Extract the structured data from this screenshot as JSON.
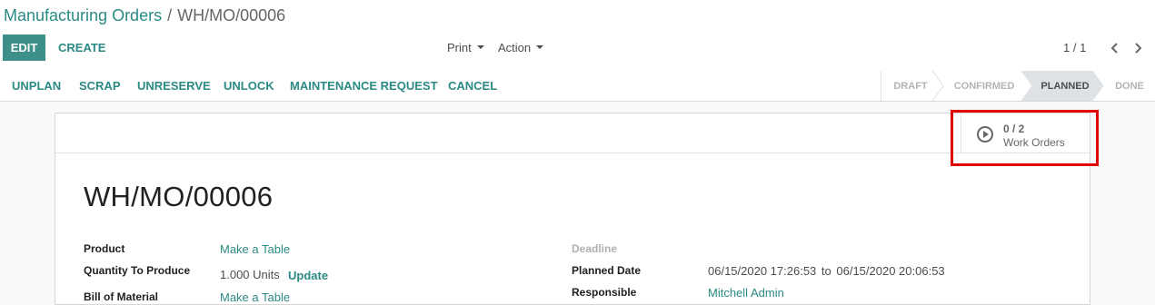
{
  "breadcrumb": {
    "parent": "Manufacturing Orders",
    "separator": "/",
    "current": "WH/MO/00006"
  },
  "buttons": {
    "edit": "EDIT",
    "create": "CREATE"
  },
  "dropdowns": {
    "print": "Print",
    "action": "Action"
  },
  "pager": {
    "value": "1 / 1"
  },
  "header_buttons": [
    "UNPLAN",
    "SCRAP",
    "UNRESERVE",
    "UNLOCK",
    "MAINTENANCE REQUEST",
    "CANCEL"
  ],
  "stages": [
    {
      "label": "DRAFT",
      "active": false
    },
    {
      "label": "CONFIRMED",
      "active": false
    },
    {
      "label": "PLANNED",
      "active": true
    },
    {
      "label": "DONE",
      "active": false
    }
  ],
  "work_orders": {
    "count": "0 / 2",
    "label": "Work Orders"
  },
  "record": {
    "title": "WH/MO/00006",
    "product_label": "Product",
    "product_value": "Make a Table",
    "quantity_label": "Quantity To Produce",
    "quantity_value": "1.000 Units",
    "update_label": "Update",
    "bom_label": "Bill of Material",
    "bom_value": "Make a Table",
    "deadline_label": "Deadline",
    "planned_label": "Planned Date",
    "planned_start": "06/15/2020 17:26:53",
    "planned_to": "to",
    "planned_end": "06/15/2020 20:06:53",
    "responsible_label": "Responsible",
    "responsible_value": "Mitchell Admin"
  },
  "colors": {
    "primary": "#3d8f8a",
    "link": "#2b8a84",
    "active_stage": "#dee2e6",
    "highlight": "#e00000"
  }
}
